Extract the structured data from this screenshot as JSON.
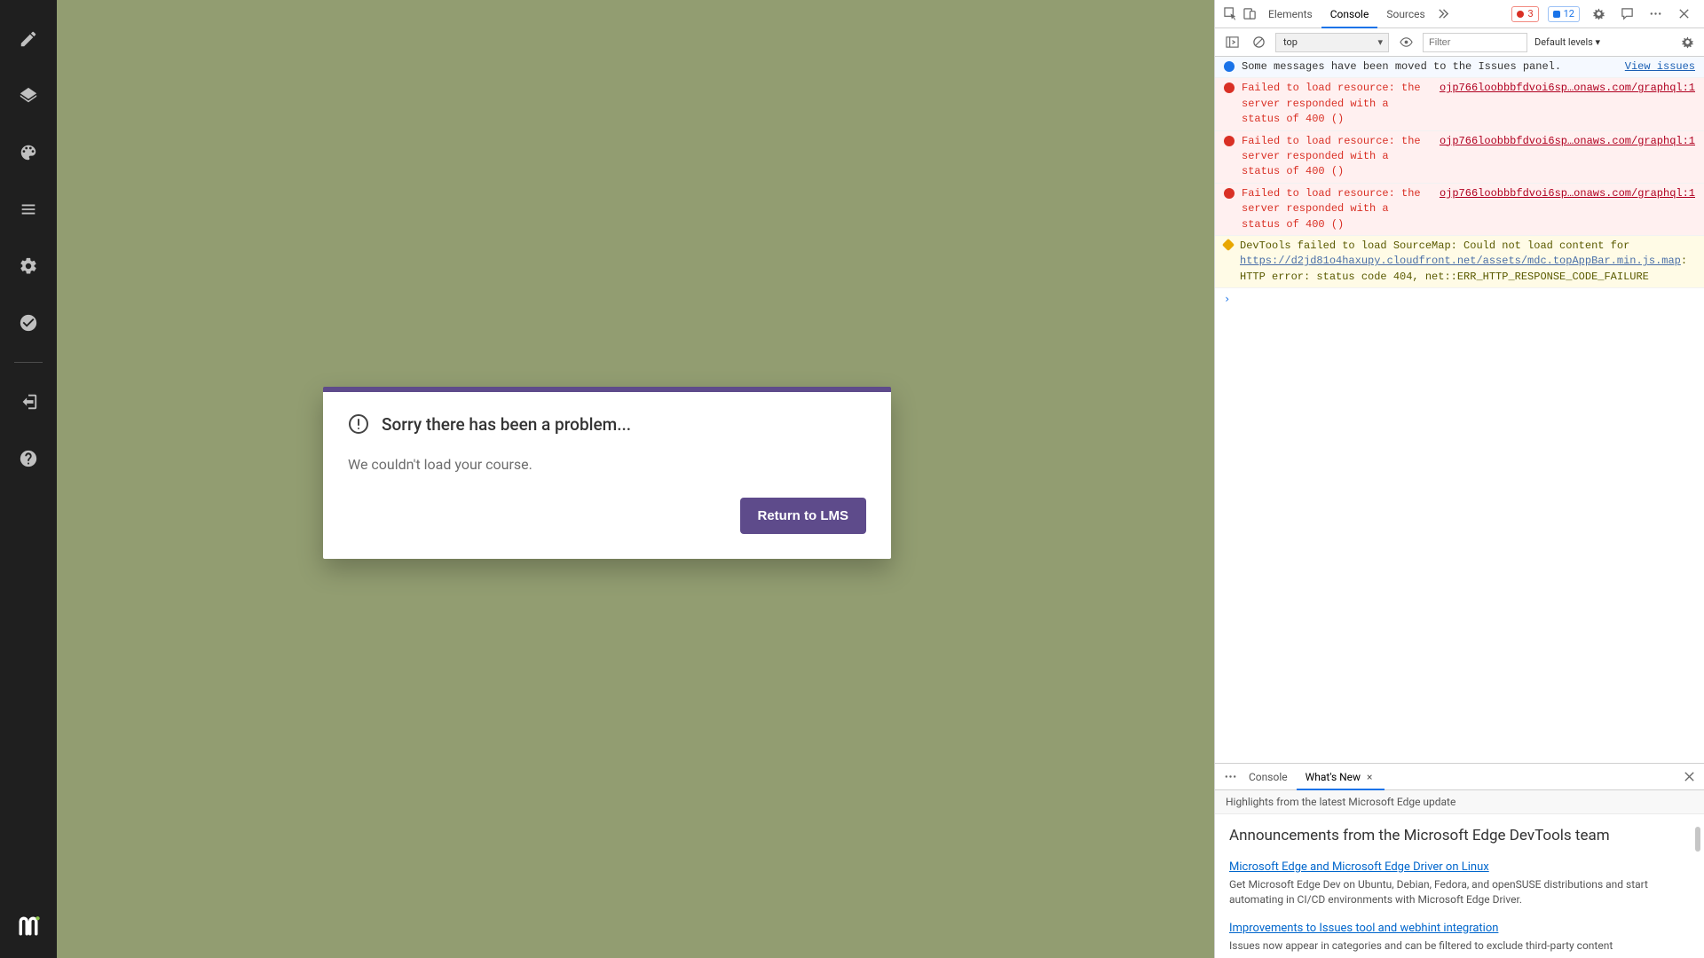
{
  "sidebar": {
    "items": [
      {
        "name": "edit-icon"
      },
      {
        "name": "layers-icon"
      },
      {
        "name": "palette-icon"
      },
      {
        "name": "library-icon"
      },
      {
        "name": "settings-icon"
      },
      {
        "name": "check-circle-icon"
      }
    ],
    "items2": [
      {
        "name": "exit-icon"
      },
      {
        "name": "help-icon"
      }
    ]
  },
  "modal": {
    "title": "Sorry there has been a problem...",
    "body": "We couldn't load your course.",
    "button": "Return to LMS"
  },
  "devtools": {
    "tabs": {
      "elements": "Elements",
      "console": "Console",
      "sources": "Sources"
    },
    "error_count": "3",
    "info_count": "12",
    "toolbar": {
      "context": "top",
      "filter_placeholder": "Filter",
      "levels": "Default levels ▾"
    },
    "messages": [
      {
        "type": "info",
        "text": "Some messages have been moved to the Issues panel.",
        "source": "View issues"
      },
      {
        "type": "error",
        "text": "Failed to load resource: the server responded with a status of 400 ()",
        "link": "ojp766loobbbfdvoi6sp…onaws.com/graphql:1"
      },
      {
        "type": "error",
        "text": "Failed to load resource: the server responded with a status of 400 ()",
        "link": "ojp766loobbbfdvoi6sp…onaws.com/graphql:1"
      },
      {
        "type": "error",
        "text": "Failed to load resource: the server responded with a status of 400 ()",
        "link": "ojp766loobbbfdvoi6sp…onaws.com/graphql:1"
      },
      {
        "type": "warning",
        "text_pre": "DevTools failed to load SourceMap: Could not load content for ",
        "link": "https://d2jd81o4haxupy.cloudfront.net/assets/mdc.topAppBar.min.js.map",
        "text_post": ": HTTP error: status code 404, net::ERR_HTTP_RESPONSE_CODE_FAILURE"
      }
    ],
    "prompt": "›",
    "drawer": {
      "tabs": {
        "console": "Console",
        "whatsnew": "What's New"
      },
      "subtitle": "Highlights from the latest Microsoft Edge update",
      "heading": "Announcements from the Microsoft Edge DevTools team",
      "items": [
        {
          "link": "Microsoft Edge and Microsoft Edge Driver on Linux",
          "desc": "Get Microsoft Edge Dev on Ubuntu, Debian, Fedora, and openSUSE distributions and start automating in CI/CD environments with Microsoft Edge Driver."
        },
        {
          "link": "Improvements to Issues tool and webhint integration",
          "desc": "Issues now appear in categories and can be filtered to exclude third-party content"
        }
      ]
    }
  }
}
